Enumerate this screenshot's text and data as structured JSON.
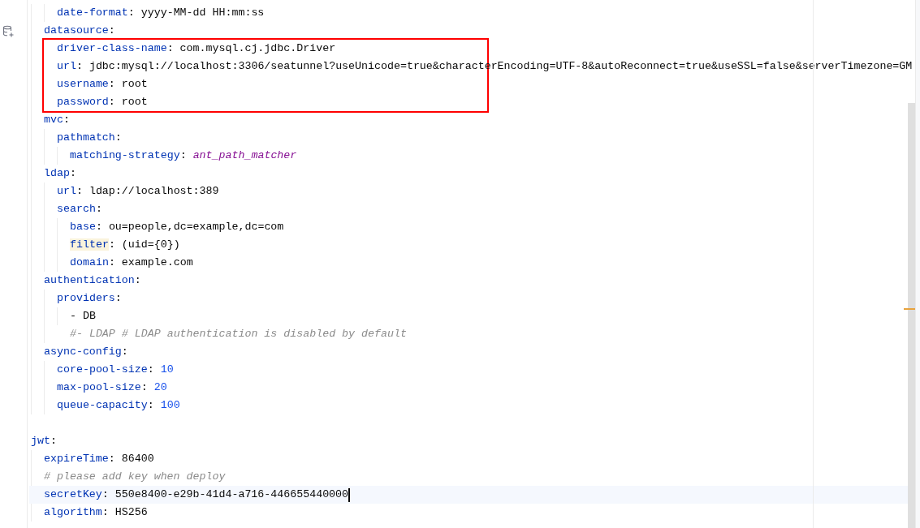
{
  "editor": {
    "lines": [
      {
        "children": [
          {
            "children": [
              {
                "kind": "pair",
                "key": "date-format",
                "value": ": yyyy-MM-dd HH:mm:ss"
              }
            ]
          },
          {
            "kind": "pair",
            "key": "datasource",
            "value": ":",
            "boxed": true,
            "children": [
              {
                "kind": "pair",
                "key": "driver-class-name",
                "value": ": com.mysql.cj.jdbc.Driver"
              },
              {
                "kind": "pair",
                "key": "url",
                "value": ": jdbc:mysql://localhost:3306/seatunnel?useUnicode=true&characterEncoding=UTF-8&autoReconnect=true&useSSL=false&serverTimezone=GM"
              },
              {
                "kind": "pair",
                "key": "username",
                "value": ": root"
              },
              {
                "kind": "pair",
                "key": "password",
                "value": ": root"
              }
            ]
          },
          {
            "kind": "pair",
            "key": "mvc",
            "value": ":",
            "children": [
              {
                "kind": "pair",
                "key": "pathmatch",
                "value": ":",
                "children": [
                  {
                    "kind": "pair",
                    "key": "matching-strategy",
                    "value": ": ",
                    "extra": {
                      "kind": "constant",
                      "text": "ant_path_matcher"
                    }
                  }
                ]
              }
            ]
          },
          {
            "kind": "pair",
            "key": "ldap",
            "value": ":",
            "children": [
              {
                "kind": "pair",
                "key": "url",
                "value": ": ldap://localhost:389"
              },
              {
                "kind": "pair",
                "key": "search",
                "value": ":",
                "children": [
                  {
                    "kind": "pair",
                    "key": "base",
                    "value": ": ou=people,dc=example,dc=com"
                  },
                  {
                    "kind": "pair",
                    "key": "filter",
                    "value": ": (uid={0})",
                    "key_highlighted": true
                  },
                  {
                    "kind": "pair",
                    "key": "domain",
                    "value": ": example.com"
                  }
                ]
              }
            ]
          },
          {
            "kind": "pair",
            "key": "authentication",
            "value": ":",
            "children": [
              {
                "kind": "pair",
                "key": "providers",
                "value": ":",
                "children": [
                  {
                    "kind": "item",
                    "text": "- DB"
                  }
                ]
              },
              {
                "kind": "comment",
                "text": "  #- LDAP # LDAP authentication is disabled by default"
              }
            ]
          },
          {
            "kind": "pair",
            "key": "async-config",
            "value": ":",
            "children": [
              {
                "kind": "pair",
                "key": "core-pool-size",
                "value": ": ",
                "extra": {
                  "kind": "number",
                  "text": "10"
                }
              },
              {
                "kind": "pair",
                "key": "max-pool-size",
                "value": ": ",
                "extra": {
                  "kind": "number",
                  "text": "20"
                }
              },
              {
                "kind": "pair",
                "key": "queue-capacity",
                "value": ": ",
                "extra": {
                  "kind": "number",
                  "text": "100"
                }
              }
            ]
          }
        ]
      },
      {
        "kind": "blank"
      },
      {
        "kind": "pair",
        "key": "jwt",
        "value": ":",
        "children": [
          {
            "kind": "pair",
            "key": "expireTime",
            "value": ": 86400"
          },
          {
            "kind": "comment",
            "text": "# please add key when deploy"
          },
          {
            "kind": "pair",
            "key": "secretKey",
            "value": ": 550e8400-e29b-41d4-a716-446655440000",
            "current": true
          },
          {
            "kind": "pair",
            "key": "algorithm",
            "value": ": HS256"
          }
        ]
      }
    ]
  }
}
